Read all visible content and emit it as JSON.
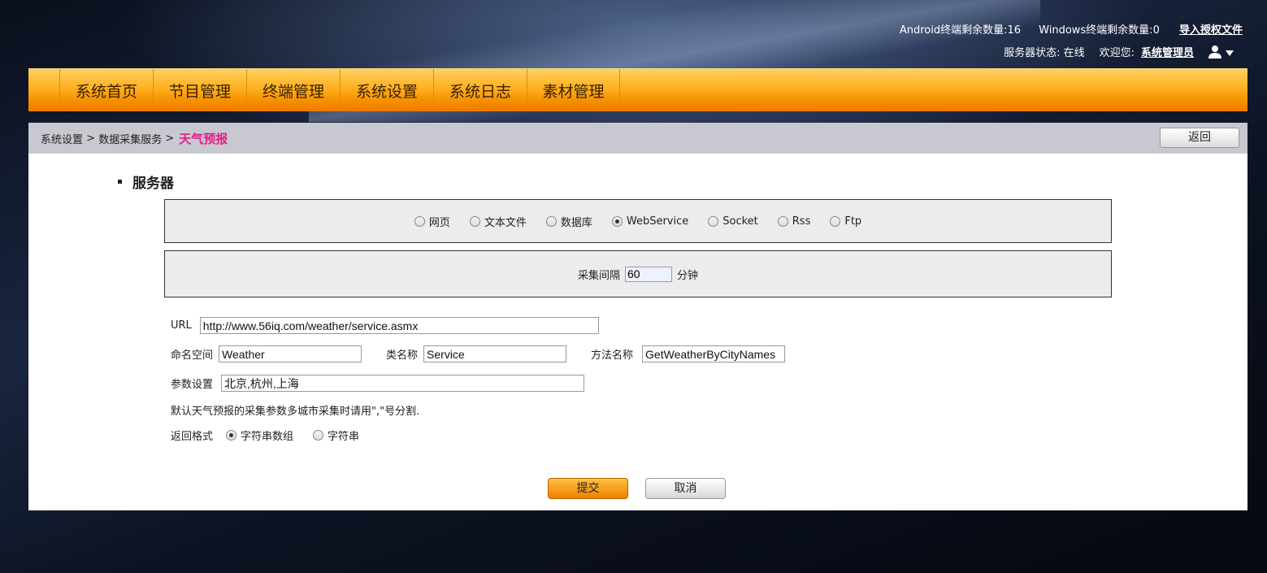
{
  "header": {
    "android_count": "Android终端剩余数量:16",
    "windows_count": "Windows终端剩余数量:0",
    "import_license": "导入授权文件",
    "server_status": "服务器状态: 在线",
    "welcome": "欢迎您:",
    "admin_name": "系统管理员",
    "user_icon": "user-icon"
  },
  "nav": {
    "items": [
      "系统首页",
      "节目管理",
      "终端管理",
      "系统设置",
      "系统日志",
      "素材管理"
    ]
  },
  "breadcrumb": {
    "item1": "系统设置",
    "sep1": ">",
    "item2": "数据采集服务",
    "sep2": ">",
    "current": "天气预报",
    "current_color": "#e0208a",
    "back_label": "返回"
  },
  "form": {
    "section_title": "服务器",
    "source_types": [
      {
        "label": "网页",
        "checked": false
      },
      {
        "label": "文本文件",
        "checked": false
      },
      {
        "label": "数据库",
        "checked": false
      },
      {
        "label": "WebService",
        "checked": true
      },
      {
        "label": "Socket",
        "checked": false
      },
      {
        "label": "Rss",
        "checked": false
      },
      {
        "label": "Ftp",
        "checked": false
      }
    ],
    "interval_label": "采集间隔",
    "interval_value": "60",
    "interval_unit": "分钟",
    "url_label": "URL",
    "url_value": "http://www.56iq.com/weather/service.asmx",
    "namespace_label": "命名空间",
    "namespace_value": "Weather",
    "class_label": "类名称",
    "class_value": "Service",
    "method_label": "方法名称",
    "method_value": "GetWeatherByCityNames",
    "params_label": "参数设置",
    "params_value": "北京,杭州,上海",
    "hint": "默认天气预报的采集参数多城市采集时请用\",\"号分割.",
    "return_format_label": "返回格式",
    "return_formats": [
      {
        "label": "字符串数组",
        "checked": true
      },
      {
        "label": "字符串",
        "checked": false
      }
    ],
    "submit_label": "提交",
    "cancel_label": "取消"
  },
  "colors": {
    "accent_orange": "#f59000",
    "breadcrumb_bg": "#c8c8d0"
  }
}
